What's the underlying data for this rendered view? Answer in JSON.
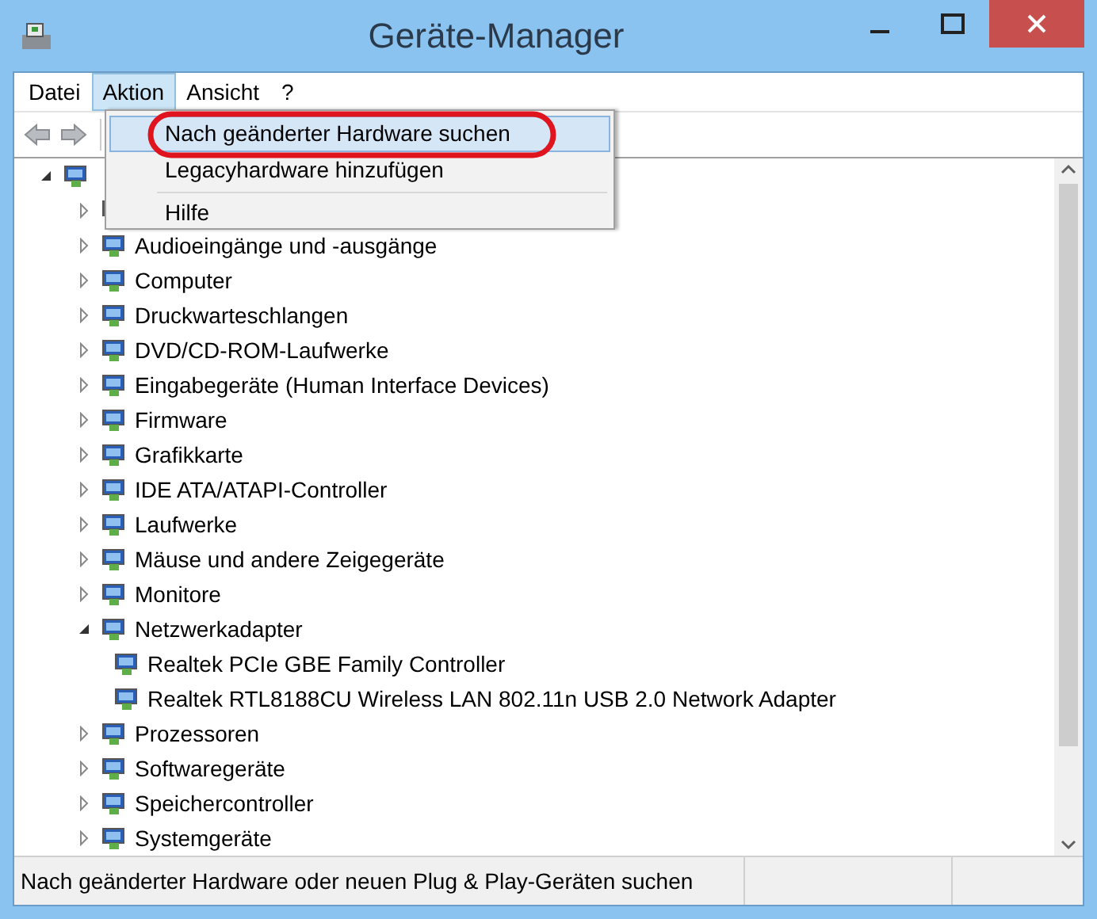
{
  "window": {
    "title": "Geräte-Manager"
  },
  "menubar": [
    {
      "label": "Datei",
      "selected": false
    },
    {
      "label": "Aktion",
      "selected": true
    },
    {
      "label": "Ansicht",
      "selected": false
    },
    {
      "label": "?",
      "selected": false
    }
  ],
  "open_menu": {
    "items": [
      {
        "kind": "item",
        "label": "Nach geänderter Hardware suchen",
        "selected": true,
        "circled": true
      },
      {
        "kind": "item",
        "label": "Legacyhardware hinzufügen",
        "selected": false,
        "circled": false
      },
      {
        "kind": "separator"
      },
      {
        "kind": "item",
        "label": "Hilfe",
        "selected": false,
        "circled": false
      }
    ]
  },
  "tree": {
    "expanded": true,
    "children": [
      {
        "expanded": false
      },
      {
        "label": "Audioeingänge und -ausgänge",
        "expanded": false
      },
      {
        "label": "Computer",
        "expanded": false
      },
      {
        "label": "Druckwarteschlangen",
        "expanded": false
      },
      {
        "label": "DVD/CD-ROM-Laufwerke",
        "expanded": false
      },
      {
        "label": "Eingabegeräte (Human Interface Devices)",
        "expanded": false
      },
      {
        "label": "Firmware",
        "expanded": false
      },
      {
        "label": "Grafikkarte",
        "expanded": false
      },
      {
        "label": "IDE ATA/ATAPI-Controller",
        "expanded": false
      },
      {
        "label": "Laufwerke",
        "expanded": false
      },
      {
        "label": "Mäuse und andere Zeigegeräte",
        "expanded": false
      },
      {
        "label": "Monitore",
        "expanded": false
      },
      {
        "label": "Netzwerkadapter",
        "expanded": true,
        "children": [
          {
            "label": "Realtek PCIe GBE Family Controller"
          },
          {
            "label": "Realtek RTL8188CU Wireless LAN 802.11n USB 2.0 Network Adapter"
          }
        ]
      },
      {
        "label": "Prozessoren",
        "expanded": false
      },
      {
        "label": "Softwaregeräte",
        "expanded": false
      },
      {
        "label": "Speichercontroller",
        "expanded": false
      },
      {
        "label": "Systemgeräte",
        "expanded": false
      }
    ]
  },
  "status_bar": {
    "text": "Nach geänderter Hardware oder neuen Plug & Play-Geräten suchen"
  }
}
